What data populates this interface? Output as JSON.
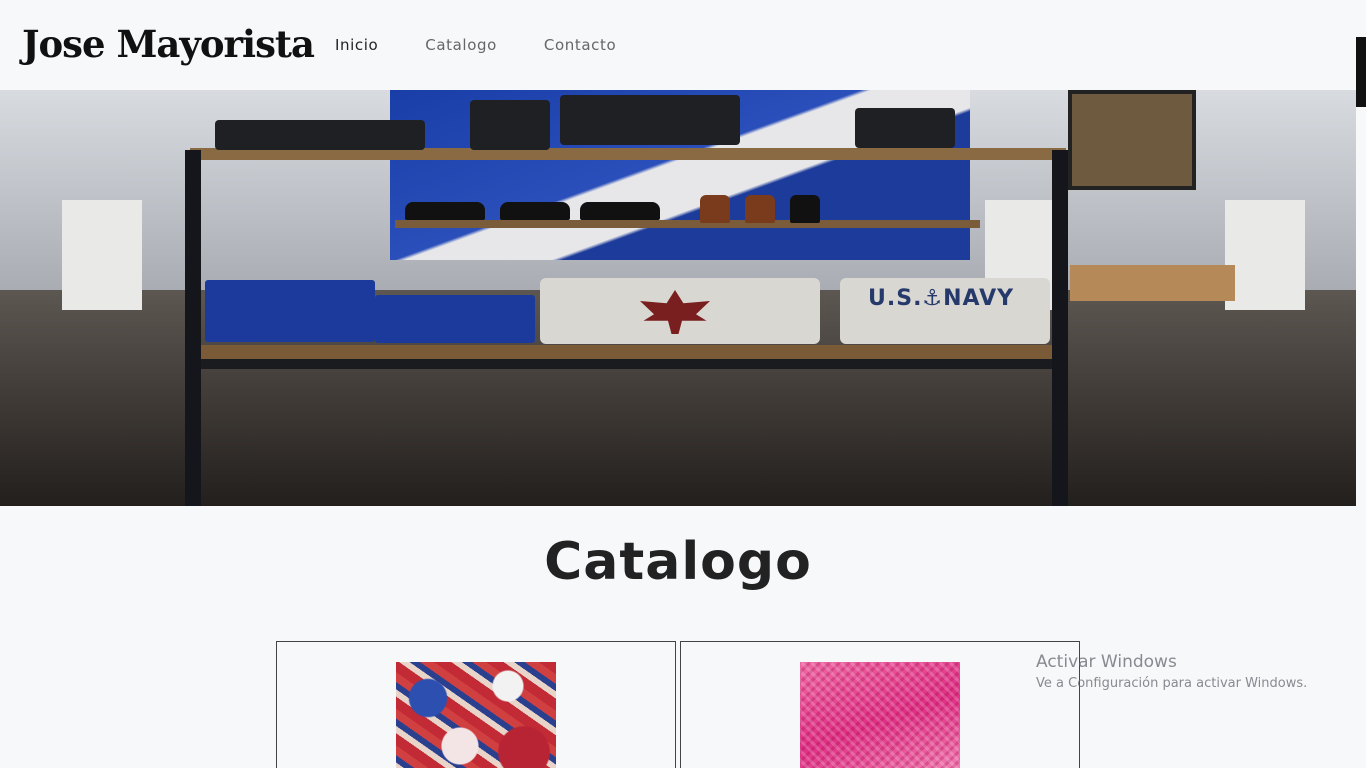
{
  "header": {
    "brand": "Jose Mayorista",
    "nav": [
      {
        "label": "Inicio",
        "active": true
      },
      {
        "label": "Catalogo",
        "active": false
      },
      {
        "label": "Contacto",
        "active": false
      }
    ]
  },
  "hero": {
    "image": "store-interior-photo",
    "shirt_text": "U.S.⚓NAVY"
  },
  "catalog": {
    "title": "Catalogo",
    "products": [
      {
        "image": "floral-print-shirts-photo"
      },
      {
        "image": "pink-fabric-photo"
      }
    ]
  },
  "watermark": {
    "title": "Activar Windows",
    "subtitle": "Ve a Configuración para activar Windows."
  },
  "colors": {
    "background": "#f7f8fa",
    "text": "#222222",
    "nav_inactive": "#666666"
  }
}
